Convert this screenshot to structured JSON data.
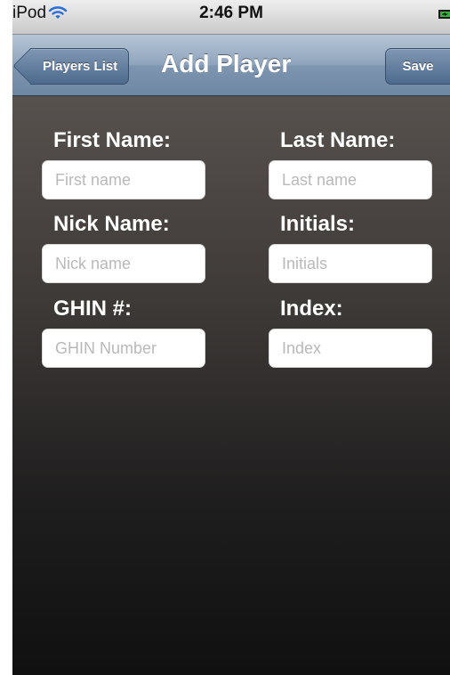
{
  "status_bar": {
    "carrier": "iPod",
    "time": "2:46 PM",
    "icons": [
      "wifi-icon",
      "battery-charging-icon"
    ]
  },
  "nav_bar": {
    "back_label": "Players List",
    "title": "Add Player",
    "save_label": "Save"
  },
  "form": {
    "first_name": {
      "label": "First Name:",
      "placeholder": "First name",
      "value": ""
    },
    "last_name": {
      "label": "Last Name:",
      "placeholder": "Last name",
      "value": ""
    },
    "nick_name": {
      "label": "Nick Name:",
      "placeholder": "Nick name",
      "value": ""
    },
    "initials": {
      "label": "Initials:",
      "placeholder": "Initials",
      "value": ""
    },
    "ghin": {
      "label": "GHIN #:",
      "placeholder": "GHIN Number",
      "value": ""
    },
    "index": {
      "label": "Index:",
      "placeholder": "Index",
      "value": ""
    }
  },
  "colors": {
    "nav_accent": "#6d86a2",
    "battery": "#2ea82e"
  }
}
